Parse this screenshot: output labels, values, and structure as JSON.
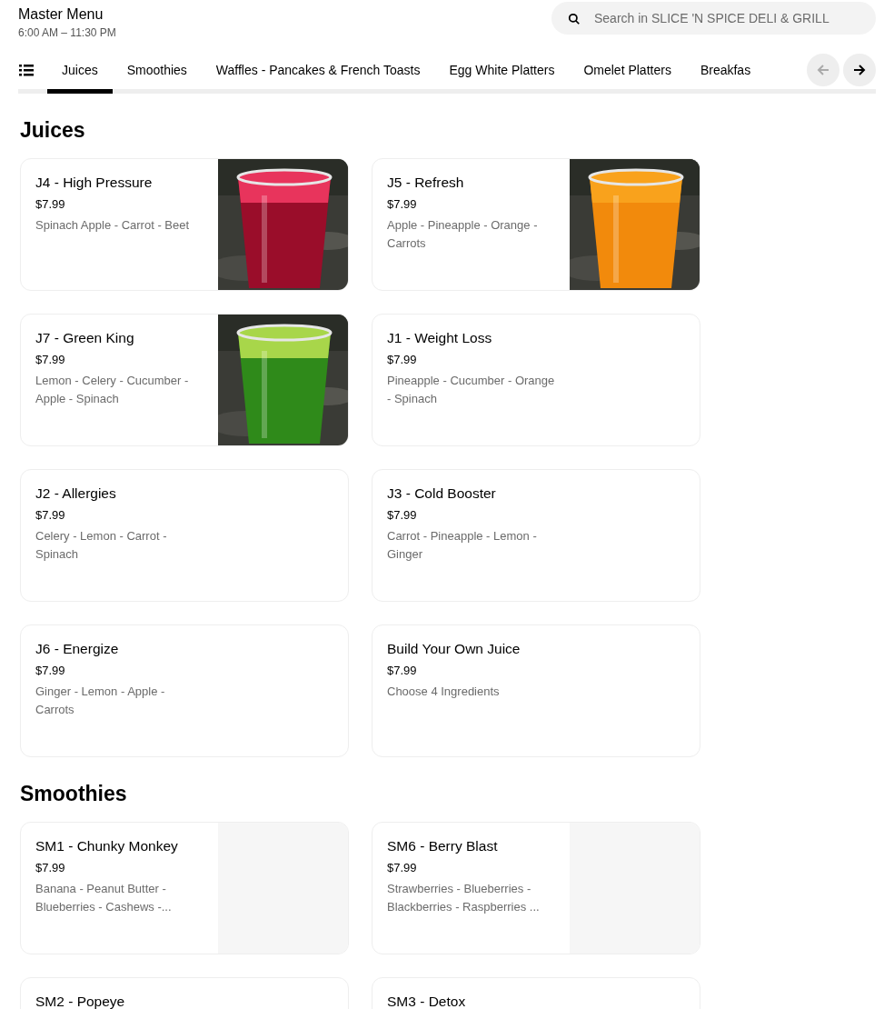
{
  "header": {
    "title": "Master Menu",
    "hours": "6:00 AM – 11:30 PM",
    "search": {
      "placeholder": "Search in SLICE 'N SPICE DELI & GRILL"
    }
  },
  "tabs": [
    {
      "label": "Juices",
      "selected": true
    },
    {
      "label": "Smoothies",
      "selected": false
    },
    {
      "label": "Waffles - Pancakes & French Toasts",
      "selected": false
    },
    {
      "label": "Egg White Platters",
      "selected": false
    },
    {
      "label": "Omelet Platters",
      "selected": false
    },
    {
      "label": "Breakfas",
      "selected": false
    }
  ],
  "scroll_left": {
    "disabled": true
  },
  "scroll_right": {
    "disabled": false
  },
  "sections": [
    {
      "title": "Juices",
      "items": [
        {
          "name": "J4 - High Pressure",
          "price": "$7.99",
          "description": "Spinach Apple - Carrot - Beet"
        },
        {
          "name": "J5 - Refresh",
          "price": "$7.99",
          "description": "Apple - Pineapple - Orange - Carrots"
        },
        {
          "name": "J7 - Green King",
          "price": "$7.99",
          "description": "Lemon - Celery - Cucumber - Apple - Spinach"
        },
        {
          "name": "J1 - Weight Loss",
          "price": "$7.99",
          "description": "Pineapple - Cucumber - Orange - Spinach"
        },
        {
          "name": "J2 - Allergies",
          "price": "$7.99",
          "description": "Celery - Lemon - Carrot - Spinach"
        },
        {
          "name": "J3 - Cold Booster",
          "price": "$7.99",
          "description": "Carrot - Pineapple - Lemon - Ginger"
        },
        {
          "name": "J6 - Energize",
          "price": "$7.99",
          "description": "Ginger - Lemon - Apple - Carrots"
        },
        {
          "name": "Build Your Own Juice",
          "price": "$7.99",
          "description": "Choose 4 Ingredients"
        }
      ]
    },
    {
      "title": "Smoothies",
      "items": [
        {
          "name": "SM1 - Chunky Monkey",
          "price": "$7.99",
          "description": "Banana - Peanut Butter - Blueberries - Cashews -...",
          "image": {
            "kind": "placeholder"
          }
        },
        {
          "name": "SM6 - Berry Blast",
          "price": "$7.99",
          "description": "Strawberries - Blueberries - Blackberries - Raspberries ...",
          "image": {
            "kind": "placeholder"
          }
        },
        {
          "name": "SM2 - Popeye"
        },
        {
          "name": "SM3 - Detox"
        }
      ]
    }
  ]
}
